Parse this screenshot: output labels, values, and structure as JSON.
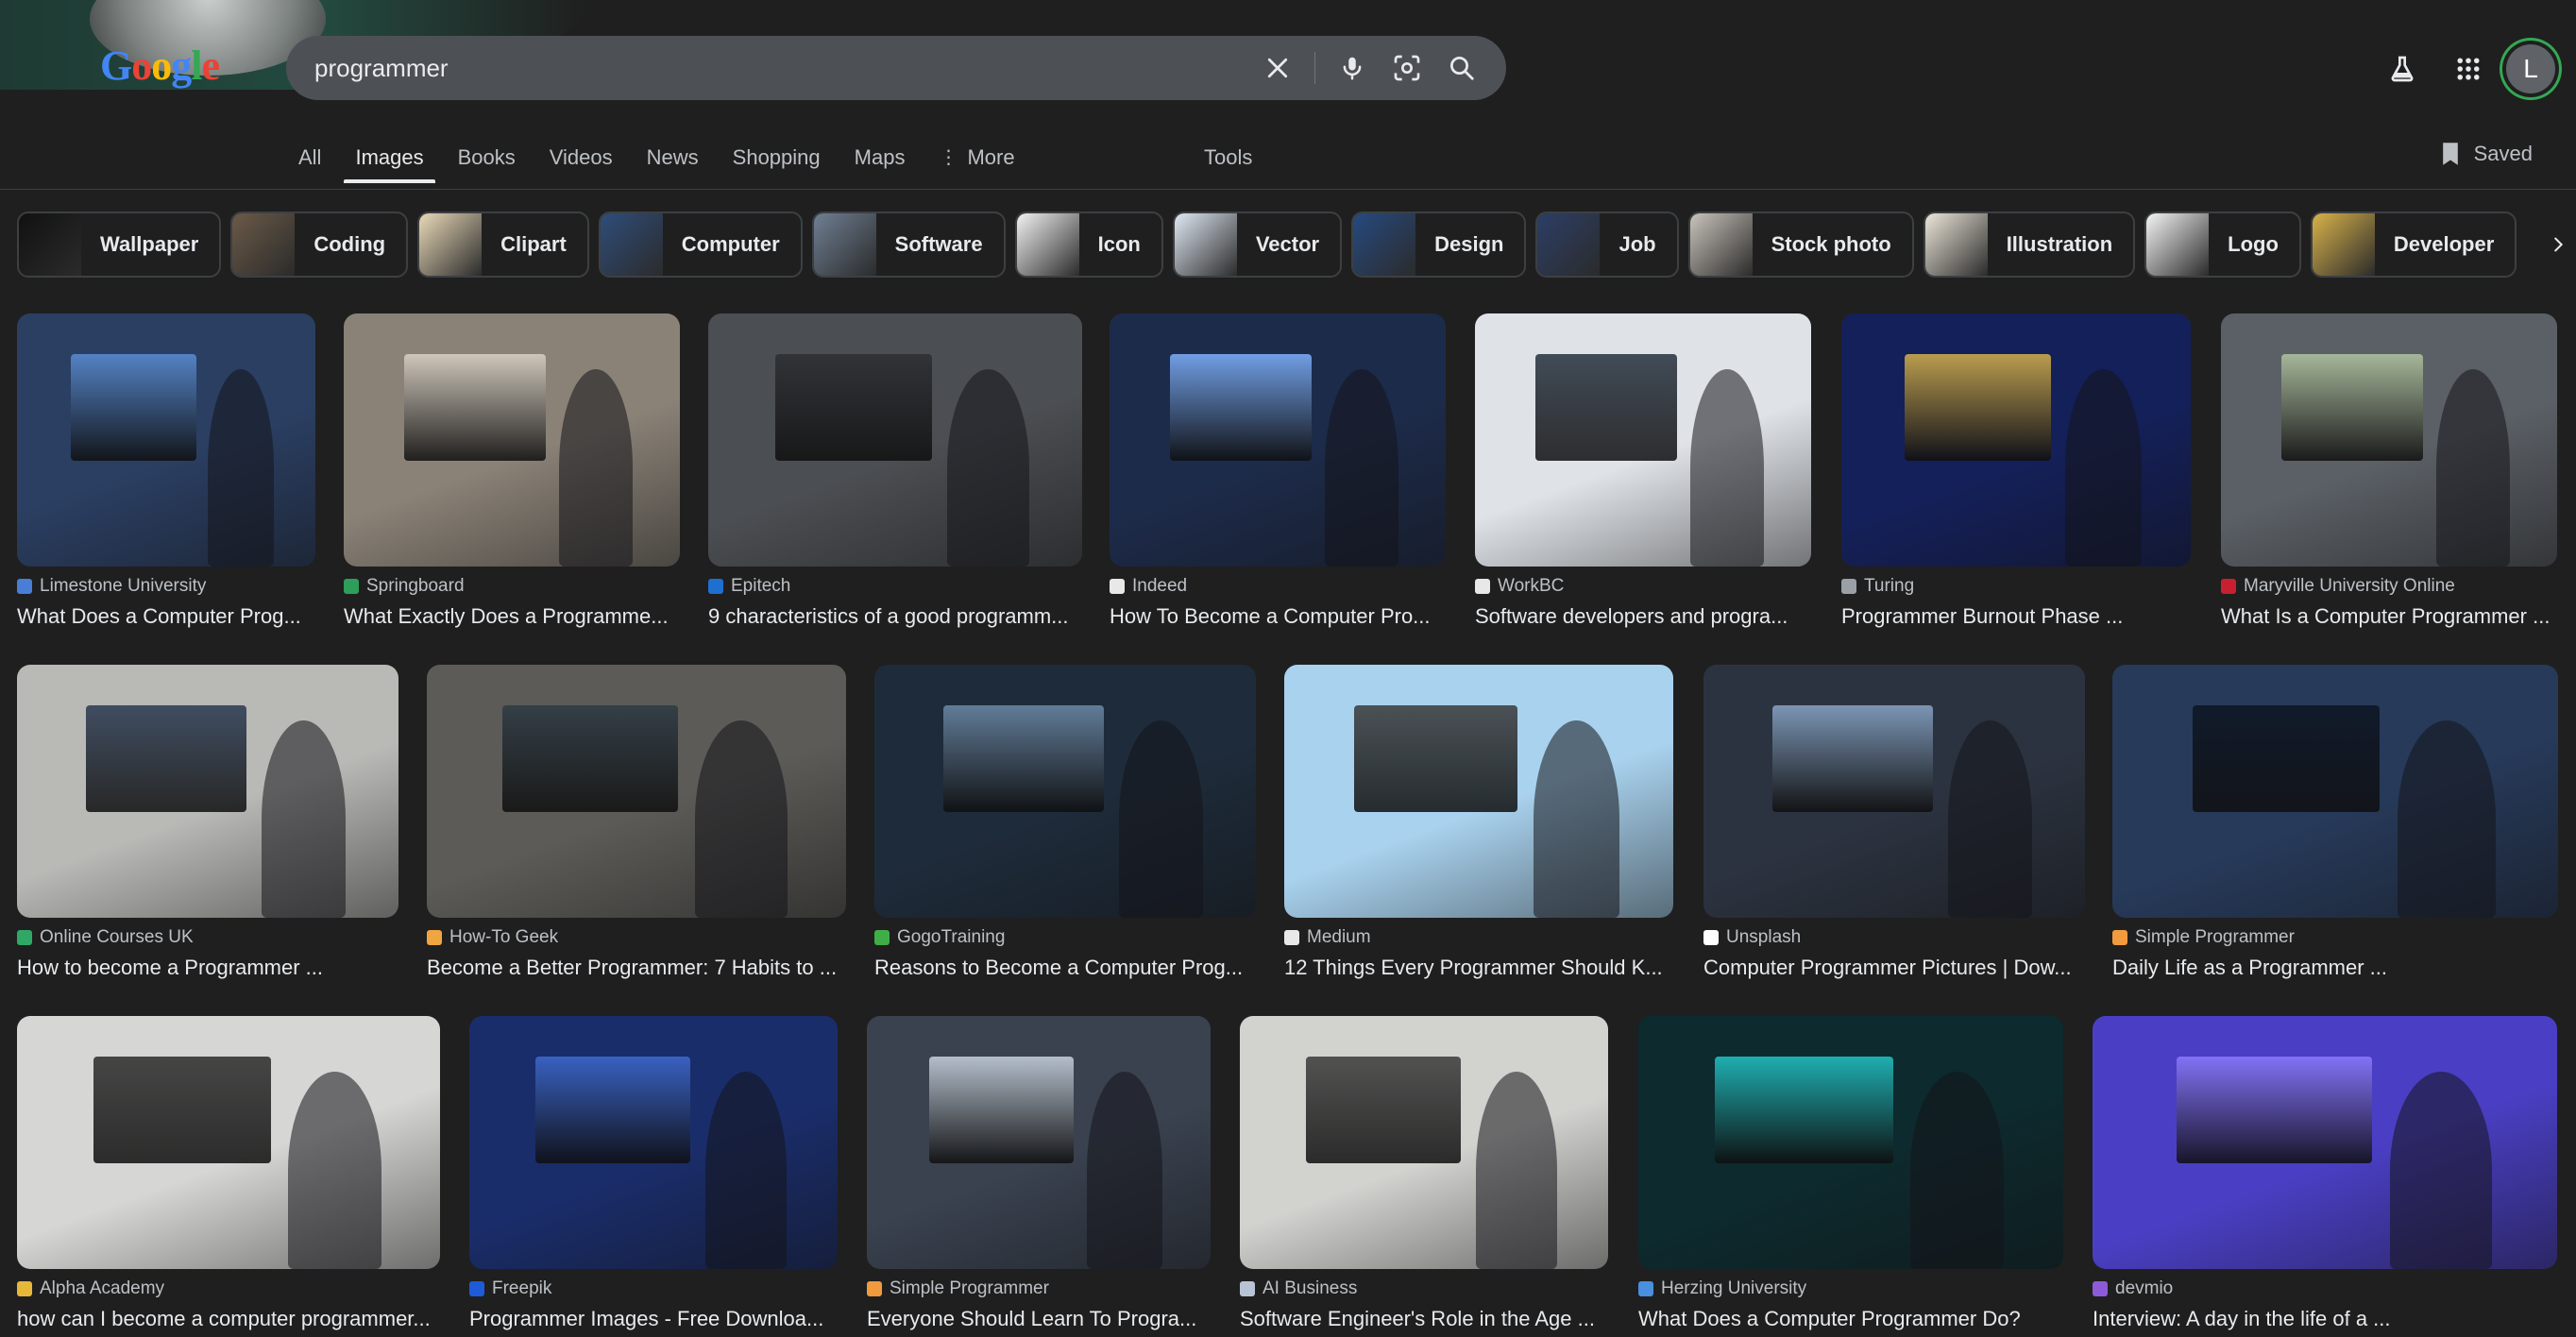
{
  "search": {
    "query": "programmer"
  },
  "logo": {
    "letters": [
      "G",
      "o",
      "o",
      "g",
      "l",
      "e"
    ]
  },
  "tabs": [
    {
      "label": "All"
    },
    {
      "label": "Images",
      "active": true
    },
    {
      "label": "Books"
    },
    {
      "label": "Videos"
    },
    {
      "label": "News"
    },
    {
      "label": "Shopping"
    },
    {
      "label": "Maps"
    },
    {
      "label": "More"
    }
  ],
  "tools_label": "Tools",
  "saved_label": "Saved",
  "avatar_letter": "L",
  "chips": [
    {
      "label": "Wallpaper",
      "color": "#111111"
    },
    {
      "label": "Coding",
      "color": "#6b5a48"
    },
    {
      "label": "Clipart",
      "color": "#e9d9b8"
    },
    {
      "label": "Computer",
      "color": "#2f4d7a"
    },
    {
      "label": "Software",
      "color": "#6f7f93"
    },
    {
      "label": "Icon",
      "color": "#f1f1f1"
    },
    {
      "label": "Vector",
      "color": "#dfe8f3"
    },
    {
      "label": "Design",
      "color": "#264a80"
    },
    {
      "label": "Job",
      "color": "#2c3e66"
    },
    {
      "label": "Stock photo",
      "color": "#c9c3bb"
    },
    {
      "label": "Illustration",
      "color": "#ece6d8"
    },
    {
      "label": "Logo",
      "color": "#f4f4f4"
    },
    {
      "label": "Developer",
      "color": "#d8b24a"
    }
  ],
  "results": [
    {
      "source": "Limestone University",
      "title": "What Does a Computer Prog...",
      "bg": "#2b3f63",
      "accent": "#5b8fd6",
      "fav": "#4a7dd6"
    },
    {
      "source": "Springboard",
      "title": "What Exactly Does a Programme...",
      "bg": "#8a8277",
      "accent": "#d9d2c6",
      "fav": "#2e9e5b"
    },
    {
      "source": "Epitech",
      "title": "9 characteristics of a good programm...",
      "bg": "#4b4e52",
      "accent": "#2c2f33",
      "fav": "#1f6fd1"
    },
    {
      "source": "Indeed",
      "title": "How To Become a Computer Pro...",
      "bg": "#1d2b4a",
      "accent": "#7fb2ff",
      "fav": "#e8e8e8"
    },
    {
      "source": "WorkBC",
      "title": "Software developers and progra...",
      "bg": "#dfe3e8",
      "accent": "#25303d",
      "fav": "#e8e8e8"
    },
    {
      "source": "Turing",
      "title": "Programmer Burnout Phase ...",
      "bg": "#14205a",
      "accent": "#d7b24c",
      "fav": "#9aa0a6"
    },
    {
      "source": "Maryville University Online",
      "title": "What Is a Computer Programmer ...",
      "bg": "#5b6066",
      "accent": "#b3c6a2",
      "fav": "#c8202f"
    },
    {
      "source": "Online Courses UK",
      "title": "How to become a Programmer ...",
      "bg": "#b9b9b6",
      "accent": "#2a3a52",
      "fav": "#2fa866"
    },
    {
      "source": "How-To Geek",
      "title": "Become a Better Programmer: 7 Habits to ...",
      "bg": "#5c5b57",
      "accent": "#2d3a44",
      "fav": "#f0a640"
    },
    {
      "source": "GogoTraining",
      "title": "Reasons to Become a Computer Prog...",
      "bg": "#1e2b3a",
      "accent": "#6d8ba9",
      "fav": "#3fae49"
    },
    {
      "source": "Medium",
      "title": "12 Things Every Programmer Should K...",
      "bg": "#a9d2ee",
      "accent": "#3a3a3a",
      "fav": "#e8e8e8"
    },
    {
      "source": "Unsplash",
      "title": "Computer Programmer Pictures | Dow...",
      "bg": "#2c3340",
      "accent": "#8aa7c9",
      "fav": "#ffffff"
    },
    {
      "source": "Simple Programmer",
      "title": "Daily Life as a Programmer ...",
      "bg": "#273a5a",
      "accent": "#0d1522",
      "fav": "#f19a3e"
    },
    {
      "source": "Alpha Academy",
      "title": "how can I become a computer programmer...",
      "bg": "#d6d6d4",
      "accent": "#2c2c2c",
      "fav": "#e5b83a"
    },
    {
      "source": "Freepik",
      "title": "Programmer Images - Free Downloa...",
      "bg": "#1a2d6b",
      "accent": "#3f6ad1",
      "fav": "#1e5bd8"
    },
    {
      "source": "Simple Programmer",
      "title": "Everyone Should Learn To Progra...",
      "bg": "#3a4250",
      "accent": "#c9d4e0",
      "fav": "#f19a3e"
    },
    {
      "source": "AI Business",
      "title": "Software Engineer's Role in the Age ...",
      "bg": "#d2d2cf",
      "accent": "#3b3b3b",
      "fav": "#b8c4d6"
    },
    {
      "source": "Herzing University",
      "title": "What Does a Computer Programmer Do?",
      "bg": "#0d2a2e",
      "accent": "#22c5c7",
      "fav": "#4a8fe0"
    },
    {
      "source": "devmio",
      "title": "Interview: A day in the life of a ...",
      "bg": "#4a3fc4",
      "accent": "#8c7bff",
      "fav": "#8d5bd9"
    }
  ]
}
